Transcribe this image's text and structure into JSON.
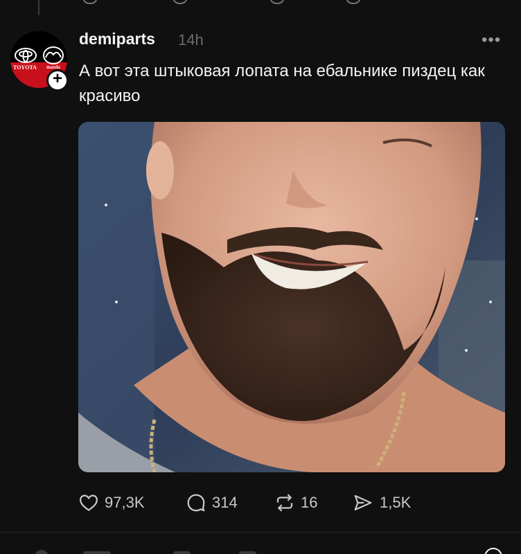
{
  "post": {
    "username": "demiparts",
    "timestamp": "14h",
    "more_label": "•••",
    "text": "А вот эта штыковая лопата на ебальнике пиздец как красиво",
    "avatar": {
      "brand_left": "TOYOTA",
      "brand_right": "mazda",
      "follow_icon": "plus-icon"
    },
    "image_description_icon": "photo",
    "actions": {
      "likes": "97,3K",
      "comments": "314",
      "reposts": "16",
      "shares": "1,5K"
    }
  },
  "colors": {
    "background": "#101010",
    "text_primary": "#f3f5f7",
    "text_secondary": "#6b6b6b",
    "brand_red": "#c8101c"
  }
}
